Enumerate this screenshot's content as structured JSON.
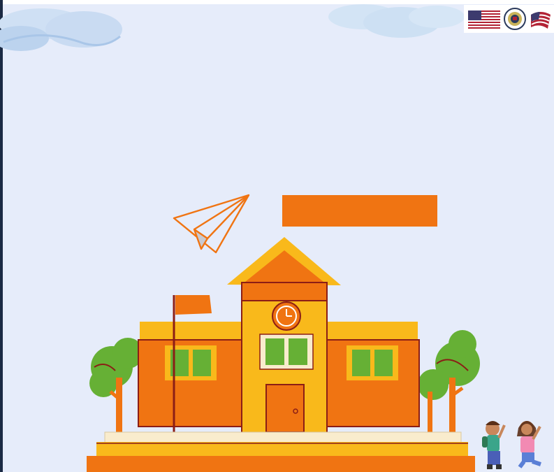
{
  "banner": {
    "text": "",
    "color": "#f07412"
  },
  "logos": [
    {
      "icon": "us-flag-icon"
    },
    {
      "icon": "state-department-seal-icon"
    },
    {
      "icon": "waving-us-flag-icon"
    }
  ],
  "colors": {
    "background": "#e6ecfa",
    "orange": "#f07412",
    "yellow": "#f9b91b",
    "green": "#66b035",
    "outline": "#8b1e16",
    "cream": "#f9eccd"
  }
}
